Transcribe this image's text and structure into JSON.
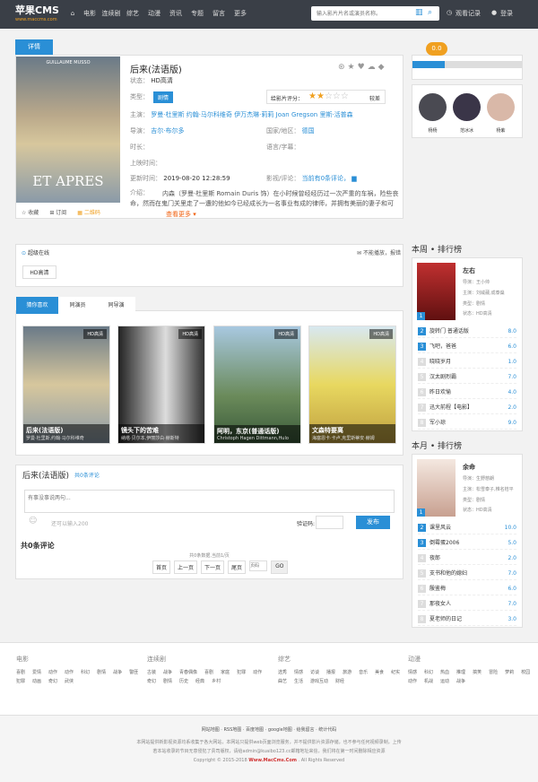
{
  "header": {
    "logo": "苹果CMS",
    "logo_sub": "www.maccms.com",
    "nav": [
      "电影",
      "连续剧",
      "综艺",
      "动漫",
      "资讯",
      "专题",
      "留言",
      "更多"
    ],
    "search_placeholder": "输入影片片名或演员名称。",
    "history": "观看记录",
    "login": "登录"
  },
  "detail": {
    "tab": "详情",
    "title": "后来(法语版)",
    "status_label": "状态：",
    "status": "HD高清",
    "type_label": "类型：",
    "type": "剧情",
    "rating_label": "给影片评分：",
    "rating_text": "较差",
    "rating": 2,
    "cast_label": "主演：",
    "cast": [
      "罗曼·杜里斯",
      "约翰·马尔科维奇",
      "伊万杰琳·莉莉",
      "Joan",
      "Gregson",
      "里斯·活普森"
    ],
    "director_label": "导演：",
    "director": "吉尔·布尔多",
    "region_label": "国家/地区：",
    "region": "德国",
    "duration_label": "时长：",
    "language_label": "语言/字幕：",
    "release_label": "上映时间：",
    "update_label": "更新时间：",
    "update": "2019-08-20 12:28:59",
    "review_label": "影视/评论：",
    "review": "当前有0条评论，",
    "intro_label": "介绍：",
    "intro": "内森（罗曼·杜里斯 Romain Duris 饰）在小时候曾经经历过一次严重的车祸，险些丧命，然而在鬼门关里走了一遭的他如今已经成长为一名事业有成的律师，并拥有美丽的妻子和可爱的女儿...",
    "more": "查看更多",
    "actions": [
      "收藏",
      "订阅",
      "二维码"
    ],
    "poster_title": "ET APRES",
    "poster_actor": "GUILLAUME MUSSO"
  },
  "side_profile": {
    "score": "0.0",
    "names": [
      "杨杨",
      "范冰冰",
      "杨紫"
    ]
  },
  "play": {
    "source": "超级在线",
    "report": "不能播放，报错",
    "episode": "HD高清"
  },
  "related": {
    "tabs": [
      "猜你喜欢",
      "同演员",
      "同导演"
    ],
    "items": [
      {
        "title": "后来(法语版)",
        "sub": "罗曼·杜里斯,约翰·马尔科维奇",
        "badge": "HD高清"
      },
      {
        "title": "镜头下的苦难",
        "sub": "纳塔·贝尔本,伊丽莎白·赫斯特",
        "badge": "HD高清"
      },
      {
        "title": "阿明，东京(普通话版)",
        "sub": "Christoph Hagen Dittmann,Hulo",
        "badge": "HD高清"
      },
      {
        "title": "文森特要离",
        "sub": "海塞恩卡·卡卢,克里斯蒂安·赫姆",
        "badge": "HD高清"
      }
    ]
  },
  "comment": {
    "title": "后来(法语版)",
    "count": "共0条评论",
    "placeholder": "有事没事说两句...",
    "limit": "还可以输入200",
    "captcha": "验证码:",
    "submit": "发布",
    "total": "共0条评论",
    "pager_info": "共0条数据,当前1/页",
    "pager": [
      "首页",
      "上一页",
      "下一页",
      "尾页"
    ],
    "go": "GO",
    "page_placeholder": "页码"
  },
  "week_rank": {
    "title": "本周 • 排行榜",
    "top": {
      "title": "左右",
      "director": "导演：王小帅",
      "cast": "主演：刘威葳,成泰燊",
      "type": "类型：剧情",
      "status": "状态：HD高清"
    },
    "items": [
      {
        "n": "2",
        "t": "旋转门 普通话版",
        "s": "8.0"
      },
      {
        "n": "3",
        "t": "飞吧，爸爸",
        "s": "6.0"
      },
      {
        "n": "4",
        "t": "晓晓岁月",
        "s": "1.0"
      },
      {
        "n": "5",
        "t": "汉太剧烈霸",
        "s": "7.0"
      },
      {
        "n": "6",
        "t": "昨日欢愉",
        "s": "4.0"
      },
      {
        "n": "7",
        "t": "迅大前程【电影】",
        "s": "2.0"
      },
      {
        "n": "8",
        "t": "军小琼",
        "s": "9.0"
      }
    ]
  },
  "month_rank": {
    "title": "本月 • 排行榜",
    "top": {
      "title": "余命",
      "director": "导演：生野慈朗",
      "cast": "主演：松雪泰子,椎名桔平",
      "type": "类型：剧情",
      "status": "状态：HD高清"
    },
    "items": [
      {
        "n": "2",
        "t": "课里风云",
        "s": "10.0"
      },
      {
        "n": "3",
        "t": "倒霉蛋2006",
        "s": "5.0"
      },
      {
        "n": "4",
        "t": "夜郎",
        "s": "2.0"
      },
      {
        "n": "5",
        "t": "支书和他的媳妇",
        "s": "7.0"
      },
      {
        "n": "6",
        "t": "殷鉴梅",
        "s": "6.0"
      },
      {
        "n": "7",
        "t": "那夜女人",
        "s": "7.0"
      },
      {
        "n": "8",
        "t": "夏老师的日记",
        "s": "3.0"
      }
    ]
  },
  "footer": {
    "cols": [
      {
        "h": "电影",
        "links": [
          "喜剧",
          "爱情",
          "动作",
          "动作",
          "科幻",
          "剧情",
          "战争",
          "警匪",
          "犯罪",
          "动画",
          "奇幻",
          "武侠"
        ]
      },
      {
        "h": "连续剧",
        "links": [
          "古装",
          "战争",
          "青春偶像",
          "喜剧",
          "家庭",
          "犯罪",
          "动作",
          "奇幻",
          "剧情",
          "历史",
          "经典",
          "乡村"
        ]
      },
      {
        "h": "综艺",
        "links": [
          "选秀",
          "情感",
          "访谈",
          "播报",
          "旅游",
          "音乐",
          "美食",
          "纪实",
          "曲艺",
          "生活",
          "游戏互动",
          "财经"
        ]
      },
      {
        "h": "动漫",
        "links": [
          "情感",
          "科幻",
          "热血",
          "推理",
          "搞笑",
          "冒险",
          "萝莉",
          "校园",
          "动作",
          "机战",
          "运动",
          "战争"
        ]
      }
    ],
    "links": "网站地图 · RSS地图 · 百度地图 · google地图 · 给我留言 · 统计代码",
    "notice1": "本网站提供新影视资源均系收集于各大网站，本网站只提供web页面浏览服务，并不提供影片资源存储，也不参与任何视频录制，上传",
    "notice2": "若本站收录的节目无意侵犯了贵司版权，请给admin@kuaibo123.cc邮箱地址来信，我们将在第一时间删除相应资源",
    "copyright": "Copyright © 2015-2018",
    "site": "Www.MacCms.Com",
    "rights": "All Rights Reserved"
  }
}
